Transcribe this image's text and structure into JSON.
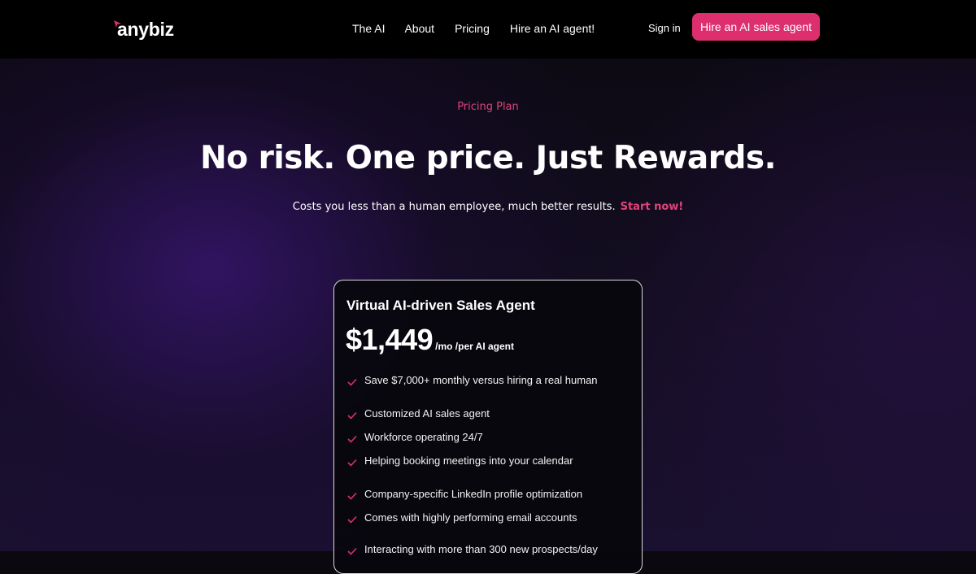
{
  "brand": {
    "name": "anybiz",
    "accent": "#dd2f6e"
  },
  "nav": {
    "links": [
      "The AI",
      "About",
      "Pricing",
      "Hire an AI agent!"
    ],
    "sign_in": "Sign in",
    "cta": "Hire an AI sales agent"
  },
  "hero": {
    "eyebrow": "Pricing Plan",
    "headline": "No risk. One price. Just Rewards.",
    "subtitle": "Costs you less than a human employee, much better results.",
    "subtitle_link": "Start now!"
  },
  "plan": {
    "title": "Virtual AI-driven Sales Agent",
    "price": "$1,449",
    "price_unit": "/mo /per AI agent",
    "features": [
      "Save $7,000+ monthly versus hiring a real human",
      "Customized AI sales agent",
      "Workforce operating 24/7",
      "Helping booking meetings into your calendar",
      "Company-specific LinkedIn profile optimization",
      "Comes with highly performing email accounts",
      "Interacting with more than 300 new prospects/day"
    ],
    "check_icon": "check-icon"
  }
}
